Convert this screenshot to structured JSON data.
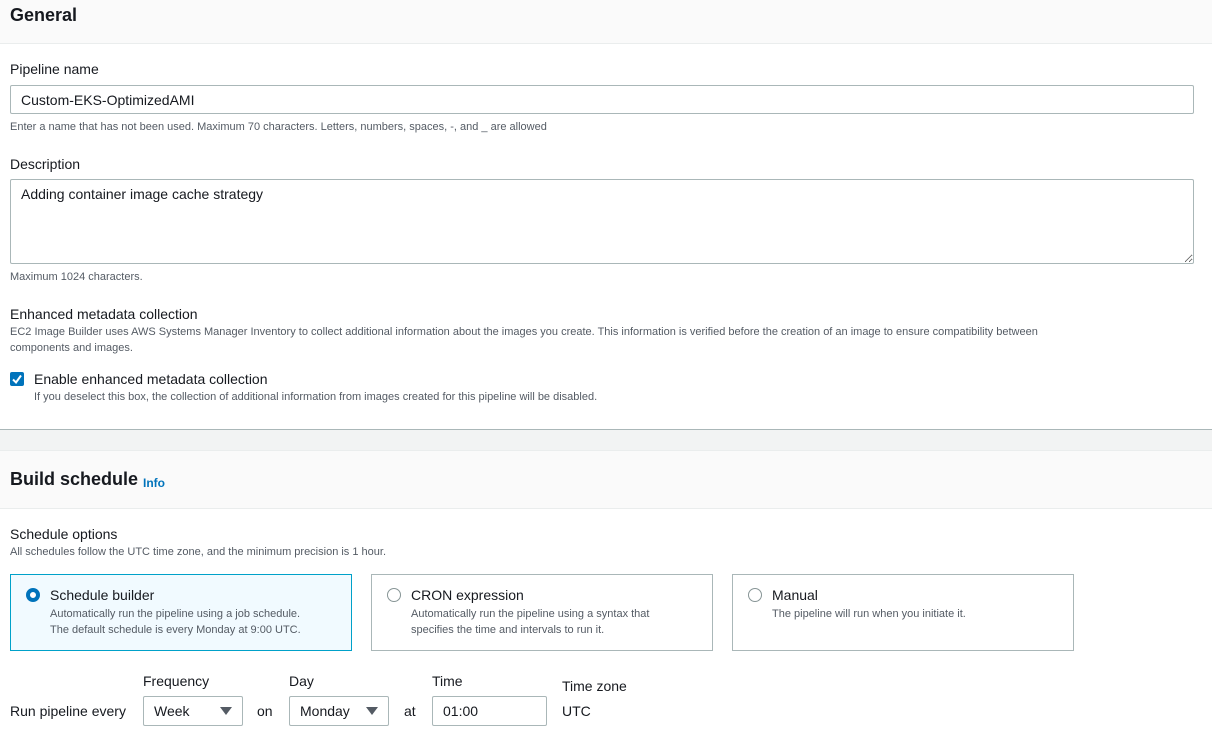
{
  "general": {
    "title": "General",
    "pipeline_name": {
      "label": "Pipeline name",
      "value": "Custom-EKS-OptimizedAMI",
      "hint": "Enter a name that has not been used. Maximum 70 characters. Letters, numbers, spaces, -, and _ are allowed"
    },
    "description": {
      "label": "Description",
      "value": "Adding container image cache strategy",
      "hint": "Maximum 1024 characters."
    },
    "metadata": {
      "label": "Enhanced metadata collection",
      "description_line1": "EC2 Image Builder uses AWS Systems Manager Inventory to collect additional information about the images you create. This information is verified before the creation of an image to ensure compatibility between",
      "description_line2": "components and images.",
      "checkbox_label": "Enable enhanced metadata collection",
      "checkbox_checked": true,
      "checkbox_hint": "If you deselect this box, the collection of additional information from images created for this pipeline will be disabled."
    }
  },
  "build_schedule": {
    "title": "Build schedule",
    "info_link": "Info",
    "schedule_options": {
      "label": "Schedule options",
      "hint": "All schedules follow the UTC time zone, and the minimum precision is 1 hour."
    },
    "options": [
      {
        "title": "Schedule builder",
        "line1": "Automatically run the pipeline using a job schedule.",
        "line2": "The default schedule is every Monday at 9:00 UTC.",
        "selected": true
      },
      {
        "title": "CRON expression",
        "line1": "Automatically run the pipeline using a syntax that",
        "line2": "specifies the time and intervals to run it.",
        "selected": false
      },
      {
        "title": "Manual",
        "line1": "The pipeline will run when you initiate it.",
        "line2": "",
        "selected": false
      }
    ],
    "run": {
      "prefix": "Run pipeline every",
      "on": "on",
      "at": "at",
      "frequency_label": "Frequency",
      "frequency_value": "Week",
      "day_label": "Day",
      "day_value": "Monday",
      "time_label": "Time",
      "time_value": "01:00",
      "timezone_label": "Time zone",
      "timezone_value": "UTC"
    }
  },
  "colors": {
    "accent": "#0073bb",
    "selected_card_bg": "#f1faff",
    "selected_card_border": "#00a1c9"
  }
}
